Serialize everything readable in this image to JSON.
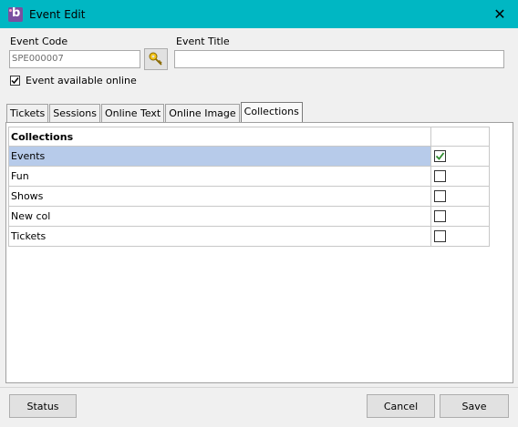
{
  "window": {
    "title": "Event Edit",
    "close_glyph": "✕"
  },
  "event_code": {
    "label": "Event Code",
    "value": "SPE000007"
  },
  "event_title": {
    "label": "Event Title",
    "value": ""
  },
  "online": {
    "label": "Event available online",
    "checked": true
  },
  "tabs": [
    {
      "label": "Tickets",
      "active": false
    },
    {
      "label": "Sessions",
      "active": false
    },
    {
      "label": "Online Text",
      "active": false
    },
    {
      "label": "Online Image",
      "active": false
    },
    {
      "label": "Collections",
      "active": true
    }
  ],
  "grid": {
    "header": "Collections",
    "rows": [
      {
        "name": "Events",
        "checked": true,
        "selected": true
      },
      {
        "name": "Fun",
        "checked": false,
        "selected": false
      },
      {
        "name": "Shows",
        "checked": false,
        "selected": false
      },
      {
        "name": "New col",
        "checked": false,
        "selected": false
      },
      {
        "name": "Tickets",
        "checked": false,
        "selected": false
      }
    ]
  },
  "buttons": {
    "status": "Status",
    "cancel": "Cancel",
    "save": "Save"
  },
  "colors": {
    "titlebar": "#00b7c3",
    "selection": "#b7cbea",
    "check_green": "#2e8b2e"
  }
}
